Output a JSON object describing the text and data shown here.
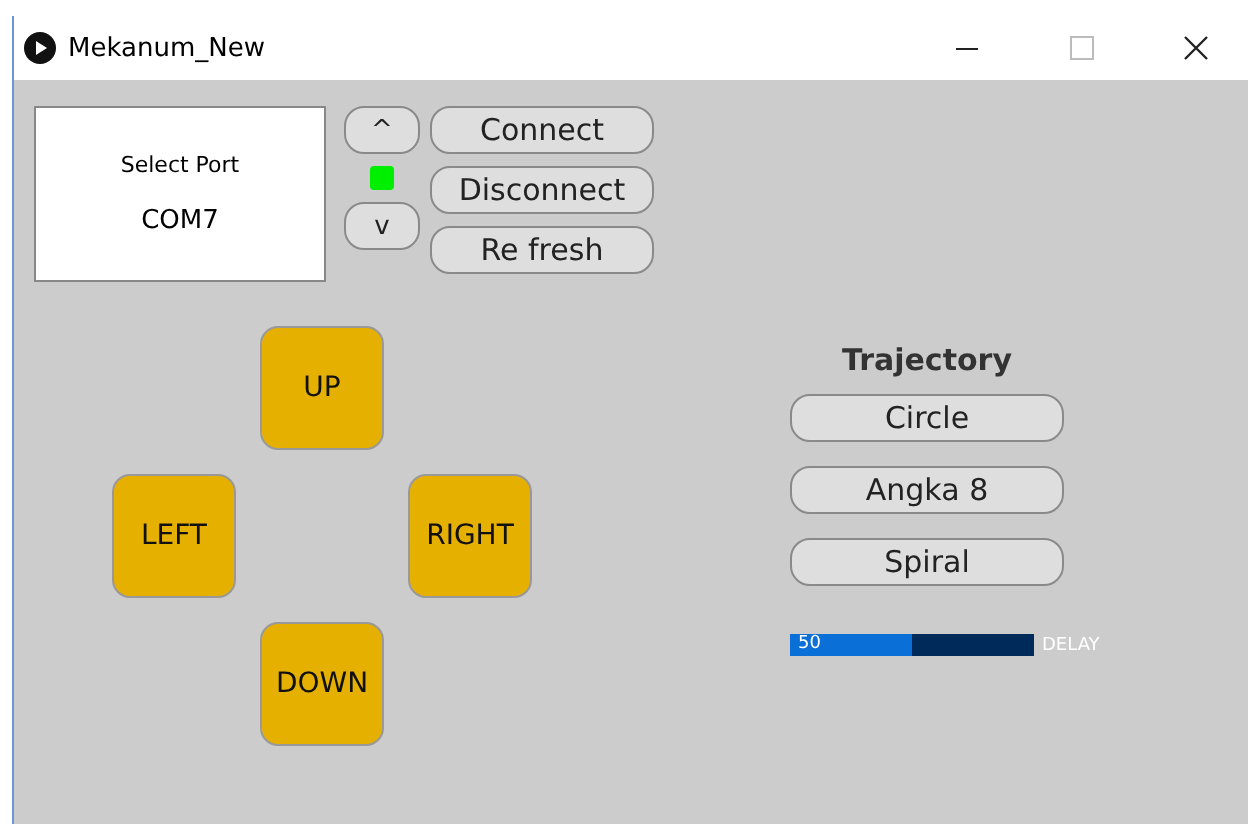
{
  "window": {
    "title": "Mekanum_New"
  },
  "port": {
    "label": "Select Port",
    "value": "COM7"
  },
  "port_arrows": [
    "^",
    "v"
  ],
  "status_indicator": {
    "on": true
  },
  "connection_buttons": [
    "Connect",
    "Disconnect",
    "Re fresh"
  ],
  "direction_pad": [
    {
      "label": "UP",
      "kind": "up"
    },
    {
      "label": "LEFT",
      "kind": "left"
    },
    {
      "label": "RIGHT",
      "kind": "right"
    },
    {
      "label": "DOWN",
      "kind": "down"
    }
  ],
  "trajectory": {
    "title": "Trajectory",
    "buttons": [
      "Circle",
      "Angka 8",
      "Spiral"
    ]
  },
  "delay_slider": {
    "level": 0.5,
    "reading": "50",
    "label": "DELAY"
  }
}
